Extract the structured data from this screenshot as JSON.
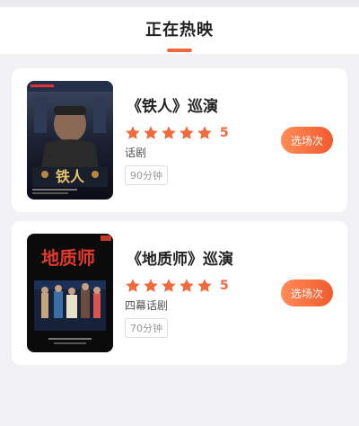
{
  "header": {
    "title": "正在热映"
  },
  "shows": [
    {
      "title": "《铁人》巡演",
      "rating": 5,
      "score": "5",
      "genre": "话剧",
      "duration": "90分钟",
      "button": "选场次",
      "poster": {
        "calligraphy": "铁人"
      }
    },
    {
      "title": "《地质师》巡演",
      "rating": 5,
      "score": "5",
      "genre": "四幕话剧",
      "duration": "70分钟",
      "button": "选场次",
      "poster": {
        "calligraphy": "地质师"
      }
    }
  ],
  "colors": {
    "accent": "#f06a3c",
    "star": "#f06a3c",
    "background": "#f2f2f4"
  }
}
